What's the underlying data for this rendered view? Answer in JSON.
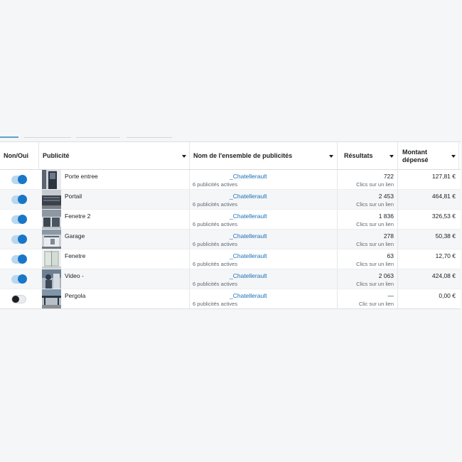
{
  "columns": {
    "toggle": "Non/Oui",
    "ad": "Publicité",
    "adset": "Nom de l'ensemble de publicités",
    "results": "Résultats",
    "spent_line1": "Montant",
    "spent_line2": "dépensé"
  },
  "rows": [
    {
      "enabled": true,
      "ad_name": "Porte entree",
      "adset_name": "_Chatellerault",
      "adset_status": "6 publicités actives",
      "results": "722",
      "result_type": "Clics sur un lien",
      "spent": "127,81 €",
      "thumb_icon": "door-photo"
    },
    {
      "enabled": true,
      "ad_name": "Portail",
      "adset_name": "_Chatellerault",
      "adset_status": "6 publicités actives",
      "results": "2 453",
      "result_type": "Clics sur un lien",
      "spent": "464,81 €",
      "thumb_icon": "gate-photo"
    },
    {
      "enabled": true,
      "ad_name": "Fenetre 2",
      "adset_name": "_Chatellerault",
      "adset_status": "6 publicités actives",
      "results": "1 836",
      "result_type": "Clics sur un lien",
      "spent": "326,53 €",
      "thumb_icon": "window-photo"
    },
    {
      "enabled": true,
      "ad_name": "Garage",
      "adset_name": "_Chatellerault",
      "adset_status": "6 publicités actives",
      "results": "278",
      "result_type": "Clics sur un lien",
      "spent": "50,38 €",
      "thumb_icon": "garage-photo"
    },
    {
      "enabled": true,
      "ad_name": "Fenetre",
      "adset_name": "_Chatellerault",
      "adset_status": "6 publicités actives",
      "results": "63",
      "result_type": "Clics sur un lien",
      "spent": "12,70 €",
      "thumb_icon": "window-photo"
    },
    {
      "enabled": true,
      "ad_name": "Video -",
      "adset_name": "_Chatellerault",
      "adset_status": "6 publicités actives",
      "results": "2 063",
      "result_type": "Clics sur un lien",
      "spent": "424,08 €",
      "thumb_icon": "video-photo"
    },
    {
      "enabled": false,
      "ad_name": "Pergola",
      "adset_name": "_Chatellerault",
      "adset_status": "6 publicités actives",
      "results": "—",
      "result_type": "Clic sur un lien",
      "spent": "0,00 €",
      "thumb_icon": "pergola-photo"
    }
  ],
  "colors": {
    "toggle_on": "#1877c8",
    "toggle_track_on": "#b9d7ee",
    "link": "#1a6fb5",
    "muted": "#606770"
  }
}
